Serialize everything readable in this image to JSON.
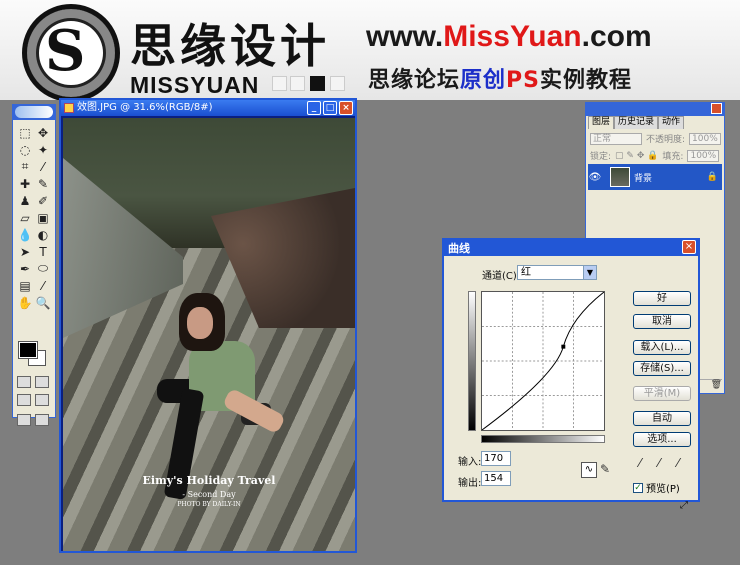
{
  "banner": {
    "cn_title": "思缘设计",
    "mark": "MISSYUAN",
    "url_a": "www.",
    "url_b": "Miss",
    "url_c": "Yuan",
    "url_d": ".com",
    "tag_a": "思缘论坛",
    "tag_b": "原创",
    "tag_c": "PS",
    "tag_d": "实例教程"
  },
  "image_window": {
    "title": "效图.JPG @ 31.6%(RGB/8#)",
    "caption_title": "Eimy's Holiday Travel",
    "caption_sub": "- Second Day",
    "caption_credit": "PHOTO BY DAILY-IN"
  },
  "layers": {
    "tabs": [
      "图层",
      "历史记录",
      "动作"
    ],
    "blend_mode": "正常",
    "opacity_label": "不透明度:",
    "opacity_value": "100%",
    "lock_label": "锁定:",
    "fill_label": "填充:",
    "fill_value": "100%",
    "layer_name": "背景"
  },
  "curves": {
    "title": "曲线",
    "channel_label": "通道(C):",
    "channel_value": "红",
    "buttons": {
      "ok": "好",
      "cancel": "取消",
      "load": "载入(L)...",
      "save": "存储(S)...",
      "smooth": "平滑(M)",
      "auto": "自动",
      "options": "选项..."
    },
    "input_label": "输入:",
    "input_value": "170",
    "output_label": "输出:",
    "output_value": "154",
    "preview_label": "预览(P)",
    "preview_checked": true,
    "point_in": 170,
    "point_out": 154
  }
}
